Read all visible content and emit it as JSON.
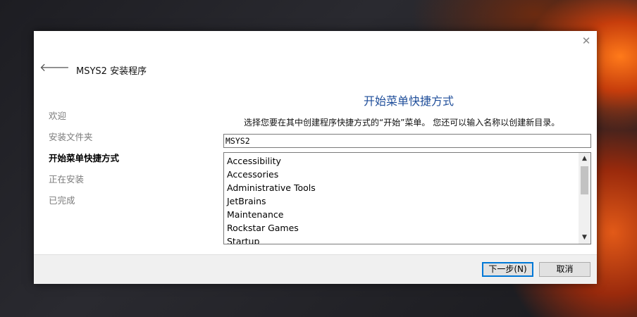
{
  "window": {
    "title": "MSYS2 安装程序"
  },
  "steps": [
    {
      "label": "欢迎",
      "active": false
    },
    {
      "label": "安装文件夹",
      "active": false
    },
    {
      "label": "开始菜单快捷方式",
      "active": true
    },
    {
      "label": "正在安装",
      "active": false
    },
    {
      "label": "已完成",
      "active": false
    }
  ],
  "main": {
    "section_title": "开始菜单快捷方式",
    "description": "选择您要在其中创建程序快捷方式的“开始”菜单。 您还可以输入名称以创建新目录。",
    "folder_value": "MSYS2",
    "folders": [
      "Accessibility",
      "Accessories",
      "Administrative Tools",
      "JetBrains",
      "Maintenance",
      "Rockstar Games",
      "Startup"
    ]
  },
  "footer": {
    "next_label": "下一步(N)",
    "cancel_label": "取消"
  },
  "icons": {
    "close": "close-icon",
    "back": "back-arrow-icon",
    "scroll_up": "chevron-up-icon",
    "scroll_down": "chevron-down-icon"
  },
  "colors": {
    "section_title": "#1f4e9a",
    "focus_border": "#0078d7"
  }
}
